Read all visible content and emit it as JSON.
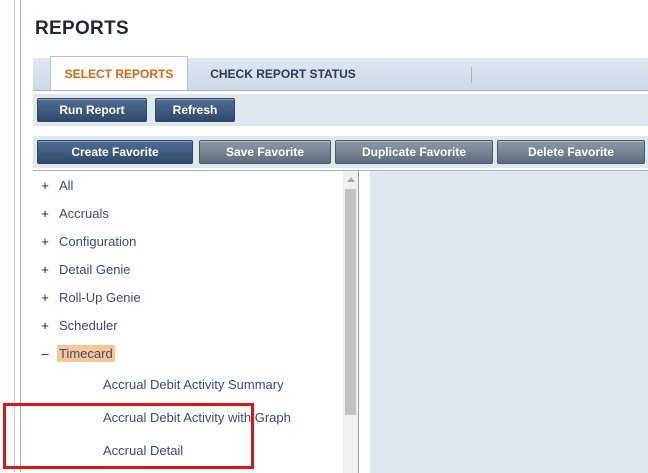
{
  "page": {
    "title": "REPORTS"
  },
  "tabs": {
    "active": "SELECT REPORTS",
    "inactive": "CHECK REPORT STATUS"
  },
  "toolbar1": {
    "run_report": "Run Report",
    "refresh": "Refresh"
  },
  "toolbar2": {
    "create_favorite": "Create Favorite",
    "save_favorite": "Save Favorite",
    "duplicate_favorite": "Duplicate Favorite",
    "delete_favorite": "Delete Favorite"
  },
  "tree": {
    "nodes": [
      {
        "toggle": "+",
        "label": "All"
      },
      {
        "toggle": "+",
        "label": "Accruals"
      },
      {
        "toggle": "+",
        "label": "Configuration"
      },
      {
        "toggle": "+",
        "label": "Detail Genie"
      },
      {
        "toggle": "+",
        "label": "Roll-Up Genie"
      },
      {
        "toggle": "+",
        "label": "Scheduler"
      },
      {
        "toggle": "–",
        "label": "Timecard"
      }
    ],
    "leaves": [
      "Accrual Debit Activity Summary",
      "Accrual Debit Activity with Graph",
      "Accrual Detail"
    ]
  },
  "colors": {
    "accent": "#e2650d",
    "selection": "#f9c78f",
    "highlight": "#e3140e"
  }
}
